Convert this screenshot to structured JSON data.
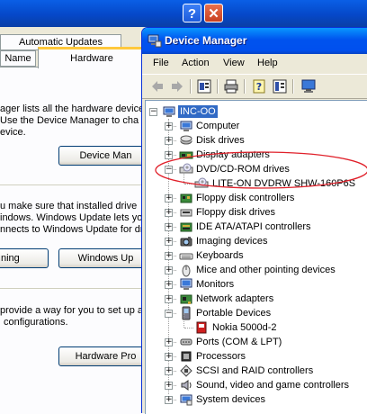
{
  "system_properties": {
    "tabs": {
      "automatic_updates": "Automatic Updates",
      "name": "Name",
      "hardware": "Hardware"
    },
    "device_manager_text": [
      "ager lists all the hardware devices",
      " Use the Device Manager to cha",
      "evice."
    ],
    "device_manager_button": "Device Man",
    "drivers_text": [
      "u make sure that installed drive",
      "indows. Windows Update lets yo",
      "nnects to Windows Update for dri"
    ],
    "signing_button": "ning",
    "windows_update_button": "Windows Up",
    "profiles_text": [
      "provide a way for you to set up a",
      "configurations."
    ],
    "hardware_profiles_button": "Hardware Pro"
  },
  "device_manager": {
    "title": "Device Manager",
    "menu": [
      "File",
      "Action",
      "View",
      "Help"
    ],
    "toolbar_icons": [
      "back-icon",
      "forward-icon",
      "properties-icon",
      "print-icon",
      "help-icon",
      "expand-icon",
      "monitor-icon"
    ],
    "tree": {
      "root": "INC-OO",
      "items": [
        "Computer",
        "Disk drives",
        "Display adapters",
        "DVD/CD-ROM drives",
        "LITE-ON DVDRW SHW-160P6S",
        "Floppy disk controllers",
        "Floppy disk drives",
        "IDE ATA/ATAPI controllers",
        "Imaging devices",
        "Keyboards",
        "Mice and other pointing devices",
        "Monitors",
        "Network adapters",
        "Portable Devices",
        "Nokia 5000d-2",
        "Ports (COM & LPT)",
        "Processors",
        "SCSI and RAID controllers",
        "Sound, video and game controllers",
        "System devices"
      ]
    }
  },
  "colors": {
    "titlebar": "#0053EE",
    "selection": "#316AC5",
    "annotation": "#E0202A"
  }
}
